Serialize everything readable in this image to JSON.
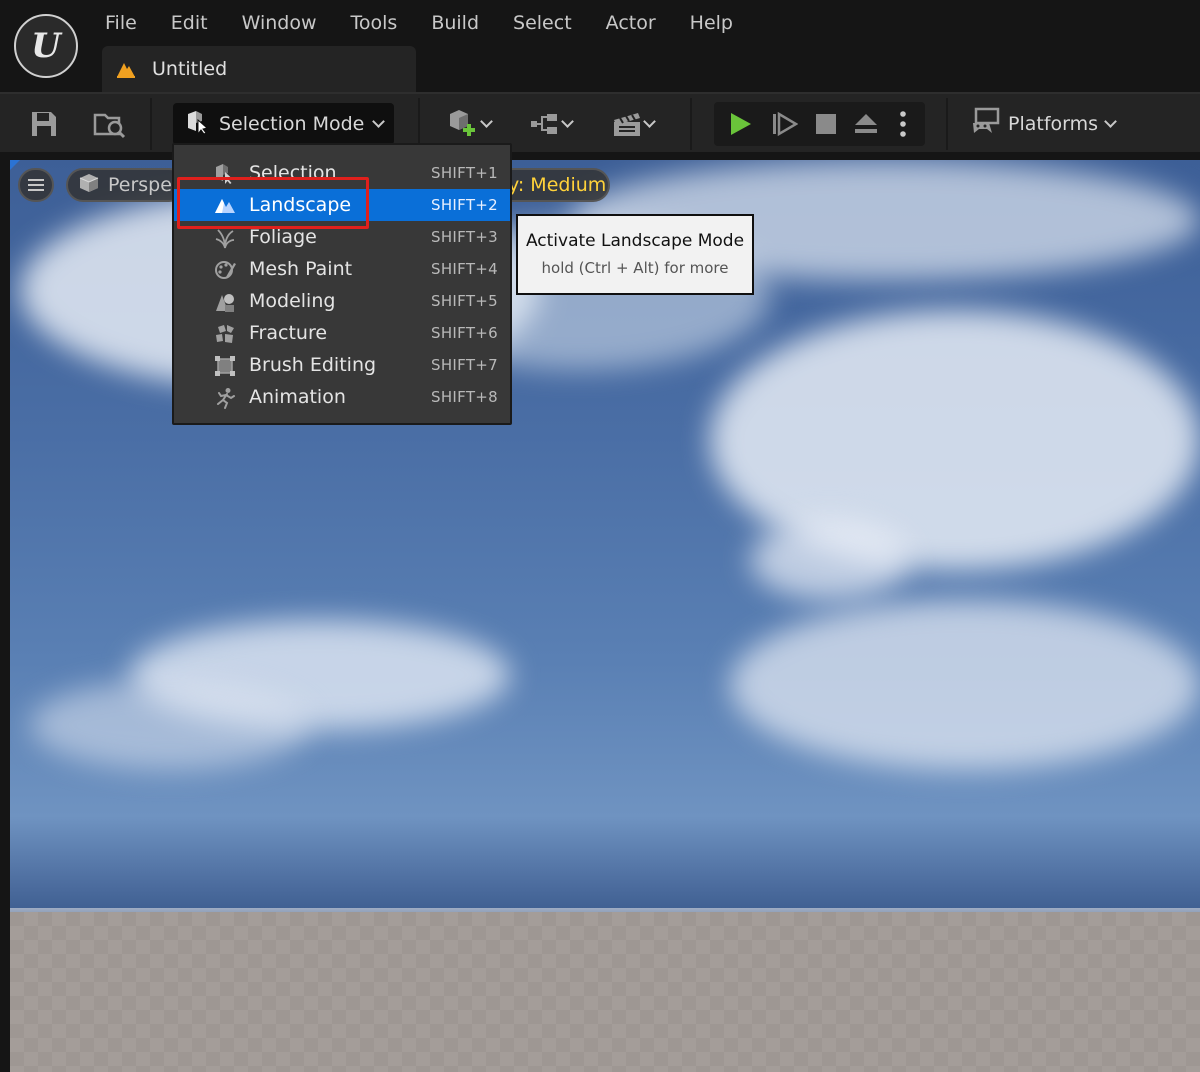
{
  "app": {
    "logo_letter": "U"
  },
  "menubar": {
    "items": [
      "File",
      "Edit",
      "Window",
      "Tools",
      "Build",
      "Select",
      "Actor",
      "Help"
    ]
  },
  "document_tab": {
    "title": "Untitled"
  },
  "toolbar": {
    "mode_label": "Selection Mode",
    "platforms_label": "Platforms"
  },
  "viewport": {
    "perspective_label": "Perspe",
    "scalability_label": "y: Medium"
  },
  "mode_menu": {
    "items": [
      {
        "label": "Selection",
        "shortcut": "SHIFT+1",
        "icon": "selection-icon"
      },
      {
        "label": "Landscape",
        "shortcut": "SHIFT+2",
        "icon": "landscape-icon",
        "active": true
      },
      {
        "label": "Foliage",
        "shortcut": "SHIFT+3",
        "icon": "foliage-icon"
      },
      {
        "label": "Mesh Paint",
        "shortcut": "SHIFT+4",
        "icon": "mesh-paint-icon"
      },
      {
        "label": "Modeling",
        "shortcut": "SHIFT+5",
        "icon": "modeling-icon"
      },
      {
        "label": "Fracture",
        "shortcut": "SHIFT+6",
        "icon": "fracture-icon"
      },
      {
        "label": "Brush Editing",
        "shortcut": "SHIFT+7",
        "icon": "brush-editing-icon"
      },
      {
        "label": "Animation",
        "shortcut": "SHIFT+8",
        "icon": "animation-icon"
      }
    ]
  },
  "tooltip": {
    "title": "Activate Landscape Mode",
    "subtitle": "hold (Ctrl + Alt) for more"
  },
  "colors": {
    "accent": "#0a6fd8",
    "play_green": "#6ac43a",
    "highlight_red": "#e0201c",
    "scalability_yellow": "#ffd23a"
  }
}
